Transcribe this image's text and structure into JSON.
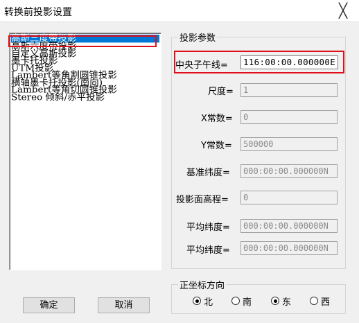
{
  "window": {
    "title": "转换前投影设置",
    "close_glyph": "╳"
  },
  "projection_list": {
    "items": [
      "高斯三度带投影",
      "高斯六度带投影",
      "自定义高斯投影",
      "墨卡托投影",
      "UTM投影",
      "Lambert等角割圆锥投影",
      "横轴墨卡托投影(南向)",
      "Lambert等角切圆锥投影",
      "Stereo 倾斜/赤平投影"
    ],
    "selected_index": 0
  },
  "params": {
    "group_title": "投影参数",
    "central_meridian_label": "中央子午线=",
    "central_meridian_value": "116:00:00.000000E",
    "scale_label": "尺度=",
    "scale_value": "1",
    "x_const_label": "X常数=",
    "x_const_value": "0",
    "y_const_label": "Y常数=",
    "y_const_value": "500000",
    "base_lat_label": "基准纬度=",
    "base_lat_value": "000:00:00.000000N",
    "proj_height_label": "投影面高程=",
    "proj_height_value": "0",
    "avg_lat1_label": "平均纬度=",
    "avg_lat1_value": "000:00:00.000000N",
    "avg_lat2_label": "平均纬度=",
    "avg_lat2_value": "000:00:00.000000N"
  },
  "direction": {
    "group_title": "正坐标方向",
    "north": "北",
    "south": "南",
    "east": "东",
    "west": "西",
    "north_selected": true,
    "south_selected": false,
    "east_selected": true,
    "west_selected": false
  },
  "buttons": {
    "ok": "确定",
    "cancel": "取消"
  }
}
